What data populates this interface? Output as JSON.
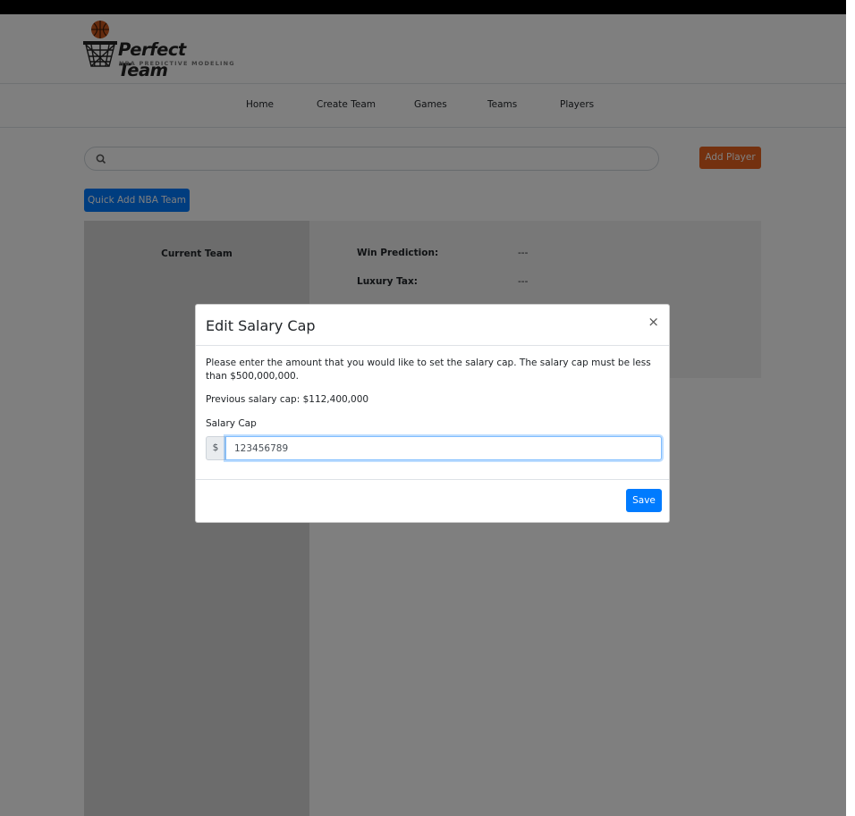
{
  "brand": {
    "name": "Perfect Team",
    "tagline": "NBA PREDICTIVE MODELING"
  },
  "nav": {
    "items": [
      {
        "label": "Home"
      },
      {
        "label": "Create Team"
      },
      {
        "label": "Games"
      },
      {
        "label": "Teams"
      },
      {
        "label": "Players"
      }
    ]
  },
  "toolbar": {
    "search_placeholder": "",
    "add_player_label": "Add Player",
    "quick_add_label": "Quick Add NBA Team"
  },
  "team_panel": {
    "title": "Current Team"
  },
  "stats": [
    {
      "label": "Win Prediction:",
      "value": "---"
    },
    {
      "label": "Luxury Tax:",
      "value": "---"
    }
  ],
  "modal": {
    "title": "Edit Salary Cap",
    "close_symbol": "×",
    "description": "Please enter the amount that you would like to set the salary cap. The salary cap must be less than $500,000,000.",
    "previous_cap": "Previous salary cap: $112,400,000",
    "field_label": "Salary Cap",
    "currency_prefix": "$",
    "field_value": "123456789",
    "save_label": "Save"
  },
  "colors": {
    "accent_blue": "#007bff",
    "accent_orange": "#e8631f",
    "overlay": "rgba(0,0,0,0.5)"
  }
}
